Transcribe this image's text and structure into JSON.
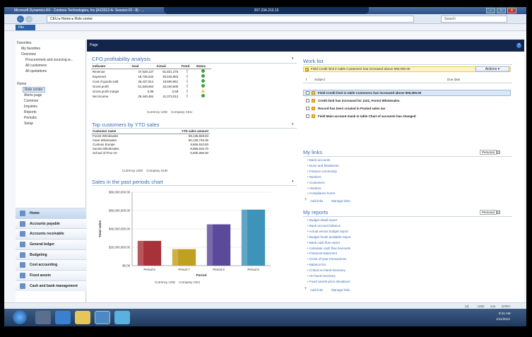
{
  "window": {
    "title": "Microsoft Dynamics AX - Contoso Technologies, Inc [AX2012-A: Session ID - 8] - ...",
    "rdp_title": "207.234.213.15",
    "minimize": "−",
    "maximize": "□",
    "close": "✕"
  },
  "address": {
    "back": "←",
    "forward": "→",
    "breadcrumb": [
      "CEU",
      "Home",
      "Role center"
    ],
    "search_placeholder": "Search"
  },
  "menu": {
    "file": "File"
  },
  "sidebar": {
    "favorites": "Favorites",
    "favorites_items": [
      "My favorites",
      "Overview"
    ],
    "overview_items": [
      "Procurement and sourcing w...",
      "All customers",
      "All quotations"
    ],
    "home": "Home",
    "home_items": [
      "Role center",
      "Alerts page"
    ],
    "groups": [
      "Common",
      "Inquiries",
      "Reports",
      "Periodic",
      "Setup"
    ],
    "modules": [
      "Home",
      "Accounts payable",
      "Accounts receivable",
      "General ledger",
      "Budgeting",
      "Cost accounting",
      "Fixed assets",
      "Cash and bank management"
    ]
  },
  "page": {
    "header": "Page",
    "help": "?"
  },
  "cfo": {
    "title": "CFO profitability analysis",
    "columns": [
      "Indicator",
      "Goal",
      "Actual",
      "Trend",
      "Status"
    ],
    "rows": [
      {
        "indicator": "Revenue",
        "goal": "47,529,137",
        "actual": "81,821,276",
        "trend": "up",
        "status": "green"
      },
      {
        "indicator": "Expenses",
        "goal": "18,735,542",
        "actual": "20,545,983",
        "trend": "down",
        "status": "green"
      },
      {
        "indicator": "Cost of goods sold",
        "goal": "35,437,914",
        "actual": "19,590,951",
        "trend": "down",
        "status": "green"
      },
      {
        "indicator": "Gross profit",
        "goal": "61,548,694",
        "actual": "42,040,605",
        "trend": "up",
        "status": "green"
      },
      {
        "indicator": "Gross profit margin",
        "goal": "0.89",
        "actual": "0.68",
        "trend": "down",
        "status": "yellow"
      },
      {
        "indicator": "Net income",
        "goal": "29,440,484",
        "actual": "41,073,012",
        "trend": "up",
        "status": "green"
      }
    ],
    "footer_currency_label": "Currency",
    "footer_currency": "USD",
    "footer_company_label": "Company",
    "footer_company": "CEU"
  },
  "top_customers": {
    "title": "Top customers by YTD sales",
    "columns": [
      "Customer name",
      "YTD sales amount"
    ],
    "rows": [
      [
        "Forest Wholesales",
        "59,135,568.84"
      ],
      [
        "Cave Wholesales",
        "50,125,746.35"
      ],
      [
        "Contoso Europe",
        "9,866,910.83"
      ],
      [
        "Sunset Wholesales",
        "8,885,915.70"
      ],
      [
        "School of Fine Art",
        "6,000,000.00"
      ]
    ],
    "footer_currency_label": "Currency",
    "footer_currency": "USD",
    "footer_company_label": "Company",
    "footer_company": "SUN"
  },
  "chart_data": {
    "type": "bar",
    "title": "Sales in the past periods chart",
    "xlabel": "Period",
    "ylabel": "Total sales",
    "categories": [
      "Period 6",
      "Period 7",
      "Period 8",
      "Period 9"
    ],
    "values": [
      27000000,
      18000000,
      45000000,
      61000000
    ],
    "colors": [
      "#a8323a",
      "#c0a020",
      "#5b4a9a",
      "#3d93b8"
    ],
    "yticks": [
      "$0.00",
      "$20,000,000.00",
      "$40,000,000.00",
      "$60,000,000.00",
      "$80,000,000.00"
    ],
    "ylim": [
      0,
      80000000
    ],
    "grid": true,
    "footer_currency_label": "Currency",
    "footer_currency": "USD",
    "footer_company_label": "Company",
    "footer_company": "CEU"
  },
  "worklist": {
    "title": "Work list",
    "alert": "Field Credit limit in table Customers has increased above 500,000.00",
    "actions": "Actions",
    "col_excl": "!",
    "col_subject": "Subject",
    "col_due": "Due date",
    "items": [
      "Field Credit limit in table Customers has increased above 500,000.00",
      "Credit limit has increased for 1101, Forest Wholesales.",
      "Record has been created in Posted sales tax",
      "Field Main account mask in table Chart of accounts has changed"
    ]
  },
  "mylinks": {
    "title": "My links",
    "view": "Personal",
    "items": [
      "Bank accounts",
      "Dunn and Bradstreet",
      "Finance community",
      "Workers",
      "Customers",
      "Vendors",
      "Compliance home"
    ],
    "add": "Add links",
    "manage": "Manage links"
  },
  "myreports": {
    "title": "My reports",
    "view": "Personal",
    "items": [
      "Budget detail report",
      "Bank account balance",
      "Actual versus budget report",
      "Budget funds available report",
      "Bank cash flow report",
      "Calculate cash flow forecasts",
      "Financial statement",
      "Close-of-year transactions",
      "Balance list",
      "Critical on-hand inventory",
      "On-hand inventory",
      "Fixed assets price deviations"
    ],
    "add": "Add links",
    "manage": "Manage links"
  },
  "statusbar": {
    "items": [
      "(4)",
      "USD",
      "ceu",
      "SARA"
    ]
  },
  "taskbar": {
    "time": "9:41 AM",
    "date": "1/11/2013"
  }
}
